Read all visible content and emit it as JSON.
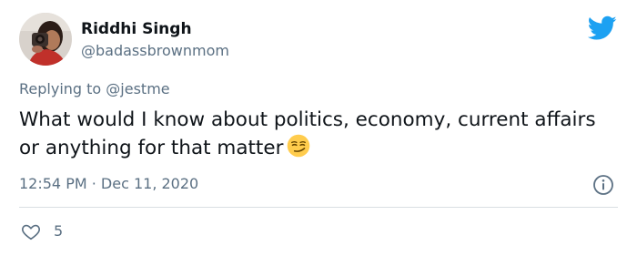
{
  "author": {
    "display_name": "Riddhi Singh",
    "handle": "@badassbrownmom"
  },
  "reply": {
    "prefix": "Replying to ",
    "mention": "@jestme"
  },
  "tweet": {
    "text": "What would I know about politics, economy, current affairs or anything for that matter"
  },
  "meta": {
    "timestamp": "12:54 PM · Dec 11, 2020"
  },
  "engagement": {
    "like_count": "5"
  },
  "icons": {
    "brand": "twitter-bird-icon",
    "info": "info-icon",
    "like": "heart-icon",
    "emoji": "smirking-face-emoji"
  },
  "colors": {
    "brand": "#1da1f2",
    "text_primary": "#0f1419",
    "text_secondary": "#5b7083",
    "divider": "#d9dfe3"
  }
}
